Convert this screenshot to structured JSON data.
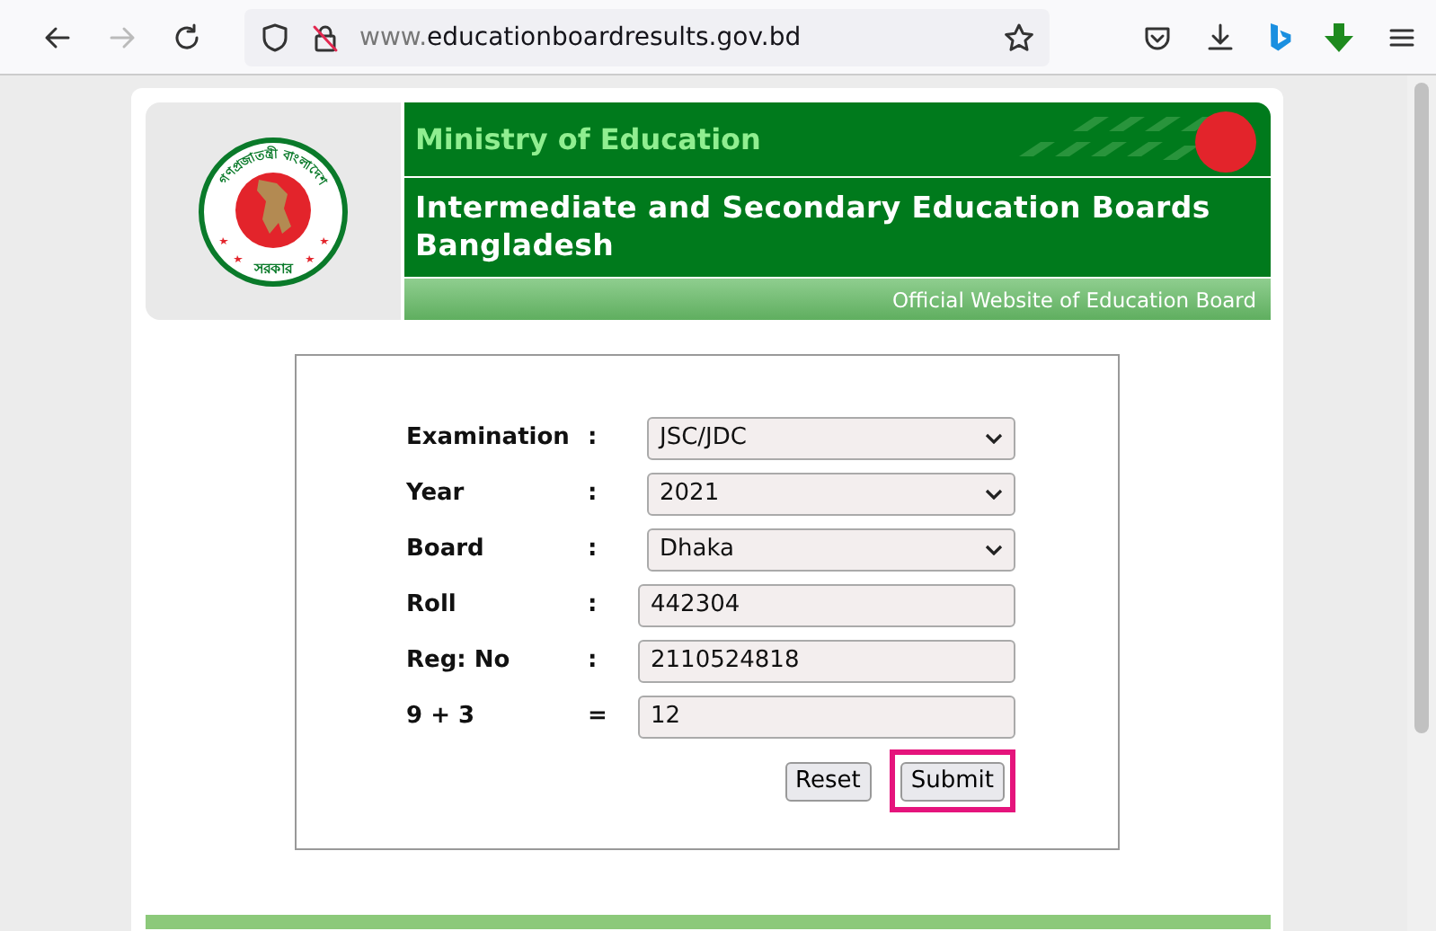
{
  "browser": {
    "url_prefix": "www.",
    "url_domain": "educationboardresults.gov.bd",
    "forward_disabled": true
  },
  "header": {
    "emblem_top": "গণপ্রজাতন্ত্রী বাংলাদেশ",
    "emblem_bottom": "সরকার",
    "ministry": "Ministry of Education",
    "title": "Intermediate and Secondary Education Boards Bangladesh",
    "tagline": "Official Website of Education Board"
  },
  "form": {
    "fields": [
      {
        "label": "Examination",
        "separator": ":",
        "kind": "select",
        "value": "JSC/JDC"
      },
      {
        "label": "Year",
        "separator": ":",
        "kind": "select",
        "value": "2021"
      },
      {
        "label": "Board",
        "separator": ":",
        "kind": "select",
        "value": "Dhaka"
      },
      {
        "label": "Roll",
        "separator": ":",
        "kind": "input",
        "value": "442304"
      },
      {
        "label": "Reg: No",
        "separator": ":",
        "kind": "input",
        "value": "2110524818"
      },
      {
        "label": "9 + 3",
        "separator": "=",
        "kind": "input",
        "value": "12"
      }
    ],
    "buttons": [
      {
        "label": "Reset",
        "highlighted": false
      },
      {
        "label": "Submit",
        "highlighted": true
      }
    ]
  }
}
